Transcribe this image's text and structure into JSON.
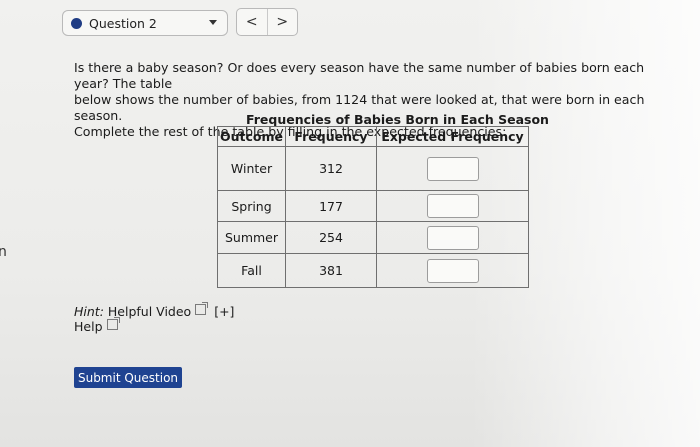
{
  "side_char": "n",
  "header": {
    "question_label": "Question 2",
    "prev_glyph": "<",
    "next_glyph": ">"
  },
  "prompt": {
    "line1": "Is there a baby season? Or does every season have the same number of babies born each year? The table",
    "line2": "below shows the number of babies, from 1124 that were looked at, that were born in each season.",
    "line3": "Complete the rest of the table by filling in the expected frequencies:"
  },
  "table": {
    "caption": "Frequencies of Babies Born in Each Season",
    "headers": [
      "Outcome",
      "Frequency",
      "Expected Frequency"
    ],
    "rows": [
      {
        "outcome": "Winter",
        "frequency": "312",
        "expected": ""
      },
      {
        "outcome": "Spring",
        "frequency": "177",
        "expected": ""
      },
      {
        "outcome": "Summer",
        "frequency": "254",
        "expected": ""
      },
      {
        "outcome": "Fall",
        "frequency": "381",
        "expected": ""
      }
    ]
  },
  "hint": {
    "label": "Hint:",
    "video_link": "Helpful Video",
    "expand": "[+]",
    "help_link": "Help"
  },
  "submit_label": "Submit Question",
  "colors": {
    "accent": "#1f4391",
    "status_dot": "#1f3c84"
  }
}
